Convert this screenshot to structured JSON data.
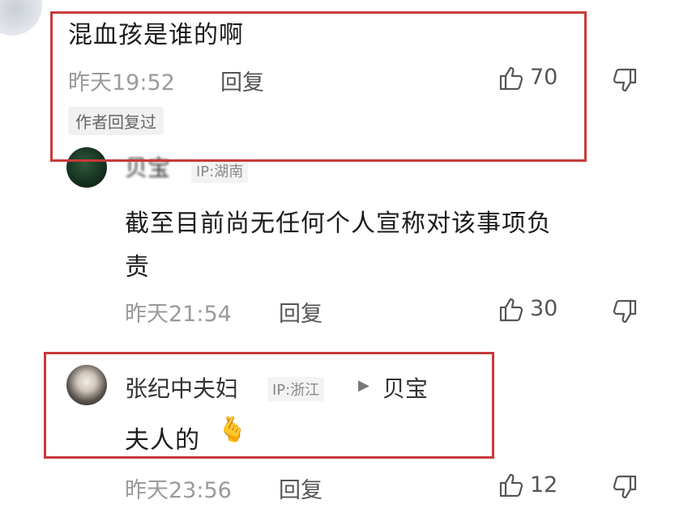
{
  "comments": [
    {
      "text": "混血孩是谁的啊",
      "time": "昨天19:52",
      "reply_label": "回复",
      "likes": "70",
      "author_tag": "作者回复过"
    },
    {
      "username": "贝宝",
      "ip": "IP:湖南",
      "text_line1": "截至目前尚无任何个人宣称对该事项负",
      "text_line2": "责",
      "time": "昨天21:54",
      "reply_label": "回复",
      "likes": "30"
    },
    {
      "username": "张纪中夫妇",
      "ip": "IP:浙江",
      "reply_arrow": "▶",
      "reply_to": "贝宝",
      "text": "夫人的",
      "emoji": "🫰",
      "time": "昨天23:56",
      "reply_label": "回复",
      "likes": "12"
    }
  ],
  "colors": {
    "highlight_border": "#c73a3a",
    "meta_text": "#9a9a9a",
    "main_text": "#1c1c1c"
  },
  "icons": [
    "thumbs-up-icon",
    "thumbs-down-icon",
    "finger-heart-emoji"
  ]
}
